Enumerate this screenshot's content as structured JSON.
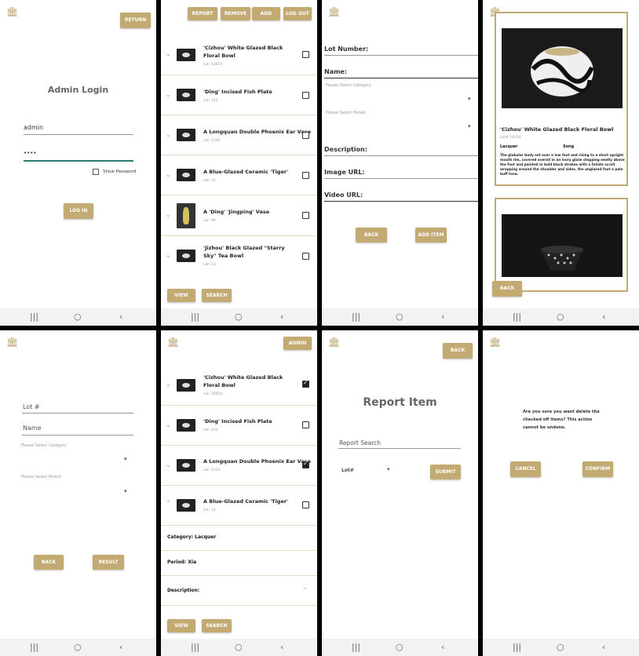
{
  "login": {
    "return_btn": "RETURN",
    "title": "Admin Login",
    "username": "admin",
    "password": "••••",
    "show_password": "Show Password",
    "login_btn": "LOG IN"
  },
  "list": {
    "buttons": {
      "report": "REPORT",
      "remove": "REMOVE",
      "add": "ADD",
      "logout": "LOG OUT"
    },
    "items": [
      {
        "title": "'Cizhou' White Glazed Black Floral Bowl",
        "lot": "Lot: 54654"
      },
      {
        "title": "'Ding' Incised Fish Plate",
        "lot": "Lot: 243"
      },
      {
        "title": "A Longquan Double Phoenix Ear Vase",
        "lot": "Lot: 2314"
      },
      {
        "title": "A Blue-Glazed Ceramic 'Tiger'",
        "lot": "Lot: 12"
      },
      {
        "title": "A 'Ding' 'Jingping' Vase",
        "lot": "Lot: 99"
      },
      {
        "title": "'Jizhou' Black Glazed \"Starry Sky\" Tea Bowl",
        "lot": "Lot: 13"
      }
    ],
    "view_btn": "VIEW",
    "search_btn": "SEARCH"
  },
  "add_form": {
    "lot_number": "Lot Number:",
    "name": "Name:",
    "category_placeholder": "Please Select Category",
    "period_placeholder": "Please Select Period",
    "description": "Description:",
    "image_url": "Image URL:",
    "video_url": "Video URL:",
    "back_btn": "BACK",
    "add_item_btn": "ADD ITEM"
  },
  "detail": {
    "title": "'Cizhou' White Glazed Black Floral Bowl",
    "lot": "Lot# 54654",
    "category": "Lacquer",
    "period": "Song",
    "description": "The globular body set over a low foot and rising to a short upright mouth rim, covered overall in an ivory glaze stopping neatly above the foot and painted in bold black strokes with a foliate scroll wrapping around the shoulder and sides, the unglazed foot a pale buff tone.",
    "back_btn": "BACK"
  },
  "search_form": {
    "lot_placeholder": "Lot #",
    "name_placeholder": "Name",
    "category_placeholder": "Please Select Category",
    "period_placeholder": "Please Select Period",
    "back_btn": "BACK",
    "result_btn": "RESULT"
  },
  "list2": {
    "admin_btn": "ADMIN",
    "items": [
      {
        "title": "'Cizhou' White Glazed Black Floral Bowl",
        "lot": "Lot: 54654",
        "checked": true
      },
      {
        "title": "'Ding' Incised Fish Plate",
        "lot": "Lot: 243",
        "checked": false
      },
      {
        "title": "A Longquan Double Phoenix Ear Vase",
        "lot": "Lot: 2314",
        "checked": true
      },
      {
        "title": "A Blue-Glazed Ceramic 'Tiger'",
        "lot": "Lot: 12",
        "checked": false
      }
    ],
    "category": "Category: Lacquer",
    "period": "Period: Xia",
    "description": "Description:",
    "view_btn": "VIEW",
    "search_btn": "SEARCH"
  },
  "report": {
    "back_btn": "BACK",
    "title": "Report Item",
    "search_placeholder": "Report Search",
    "lot_select": "Lot#",
    "submit_btn": "SUBMIT"
  },
  "confirm": {
    "message": "Are you sure you want delete the checked off items? This action cannot be undone.",
    "cancel_btn": "CANCEL",
    "confirm_btn": "CONFIRM"
  },
  "navbar": {
    "recents": "|||",
    "home": "○",
    "back": "‹"
  }
}
